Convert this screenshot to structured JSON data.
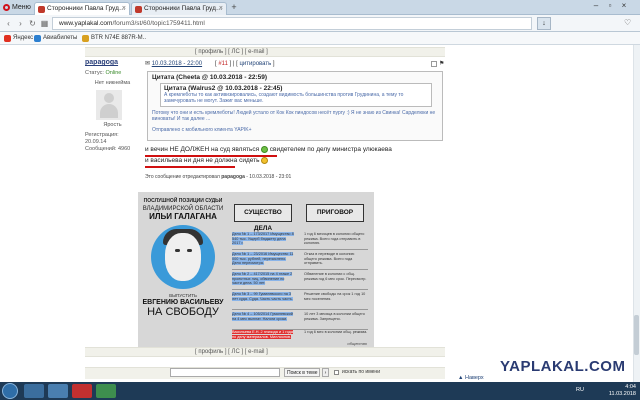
{
  "browser": {
    "menu_label": "Меню",
    "tabs": [
      {
        "label": "Сторонники Павла Груд…",
        "active": true
      },
      {
        "label": "Сторонники Павла Груд…",
        "active": false
      }
    ],
    "new_tab": "+",
    "url_host": "www.yaplakal.com",
    "url_path": "/forum3/st/60/topic1759411.html",
    "bookmarks": [
      "Яндекс",
      "Авиабилеты",
      "BTR N74E 887R-M.."
    ]
  },
  "post_top": {
    "actions": "[ профиль ] [ ЛС ] [ e-mail ]"
  },
  "post": {
    "username": "papagoga",
    "status_label": "Статус:",
    "status": "Online",
    "avatar_caption": "Нет никнейма",
    "user_label": "Ярость",
    "registered": "Регистрация: 20.09.14",
    "messages": "Сообщений: 4960",
    "date": "10.03.2018 - 22:00",
    "number": "#11",
    "reply": "цитировать",
    "quote_title": "Цитата (Cheeta @ 10.03.2018 - 22:59)",
    "inner_quote_title": "Цитата (Walrus2 @ 10.03.2018 - 22:45)",
    "inner_quote_text": "А кремлеботы то как активизировались, создают видимость большинства против Грудинина, а тему то замечуровать не могут. Зажиг вас меньше.",
    "quote_text": "Потому что они и есть кремлеботы! Людей устало от Кок Кок пиндосов несёт пургу :) Я не знаю из Свинка! Сарделюки не виноваты! И так далее ...",
    "quote_mobile": "Отправлено с мобильного клиента YAPIK+",
    "line1": "и вечин НЕ ДОЛЖЕН на суд являться",
    "line1_tail": "свидетелем по делу министра улюкаева",
    "line2": "и васильева ни дня не должна сидеть",
    "edited_note": "Это сообщение отредактировал",
    "edited_user": "papagoga",
    "edited_date": "- 10.03.2018 - 23:01"
  },
  "poster": {
    "top": "ПОСЛУШНОЙ ПОЗИЦИИ СУДЬИ",
    "region": "ВЛАДИМИРСКОЙ ОБЛАСТИ",
    "name": "ИЛЬИ ГАЛАГАНА",
    "bottom_small": "ВЫПУСТИТЬ",
    "name2": "ЕВГЕНИЮ ВАСИЛЬЕВУ",
    "free": "НА СВОБОДУ",
    "tab1": "СУЩЕСТВО ДЕЛА",
    "tab2": "ПРИГОВОР",
    "rows": [
      {
        "l": "Дело № 1 – 173/2017 Имущество 8 540 тыс. Ущерб бюджету дела 2017 г.",
        "r": "1 год 6 месяцев в колонии общего режима. Всего года отправить в колонию."
      },
      {
        "l": "Дело № 1 – 23/2016 Имущество 11 000 тыс. рублей, перечислено. Дело пересмотра.",
        "r": "Отказ в переводе в колонию общего режима. Всего года отправить."
      },
      {
        "l": "Дело № 2 – 417/2015 на 4 этаже 2 проектных лиц, обвинение по части дела. 50 лет.",
        "r": "Обвинение в колонии с общ. режима год 6 мес срок. Пересмотр."
      },
      {
        "l": "Дело № 3 – 99 Гумилевского на 3 лет суда. Суда. Часть часть часть.",
        "r": "Решение свободы на срок 1 год 10 мес поселения."
      },
      {
        "l": "Дело № 4 – 105/2014 Гумилевский на 4 мес выплат. Налоги сроки.",
        "r": "10 лет 3 месяца в колонии общего режима. Запрещено."
      },
      {
        "l": "Васильева Е.Н. 2 эпизода и 1 года по делу материалов. Миллионов.",
        "r": "1 год 6 мес в колонии общ. режима."
      }
    ],
    "sign": "общество"
  },
  "footer": {
    "select": "Поиск в теме",
    "go": "›",
    "checkbox_label": "искать по имени",
    "brand": "YAPLAKAL.COM",
    "up": "▲ Наверх"
  },
  "taskbar": {
    "lang": "RU",
    "time": "4:04",
    "date": "11.03.2018"
  },
  "colors": {
    "brand": "#2a3b72",
    "accent_red": "#d01010",
    "online": "#3a8a2a"
  }
}
